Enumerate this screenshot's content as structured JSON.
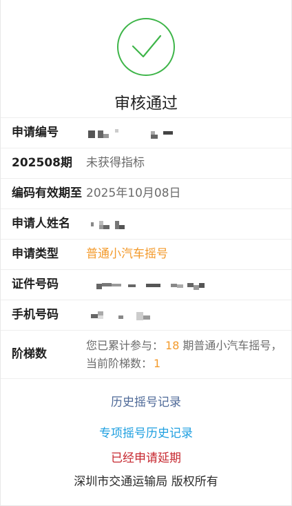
{
  "status": {
    "title": "审核通过",
    "icon": "success-check-icon"
  },
  "info": {
    "application_number": {
      "label": "申请编号"
    },
    "period_result": {
      "label": "202508期",
      "value": "未获得指标"
    },
    "code_valid_until": {
      "label": "编码有效期至",
      "value": "2025年10月08日"
    },
    "applicant_name": {
      "label": "申请人姓名"
    },
    "application_type": {
      "label": "申请类型",
      "value": "普通小汽车摇号"
    },
    "id_number": {
      "label": "证件号码"
    },
    "phone_number": {
      "label": "手机号码"
    },
    "ladder": {
      "label": "阶梯数",
      "text_before_count": "您已累计参与：",
      "count": "18",
      "text_after_count": "期普通小汽车摇号，",
      "level_text": "当前阶梯数：",
      "level": "1"
    }
  },
  "links": {
    "history": "历史摇号记录",
    "special_history": "专项摇号历史记录"
  },
  "extension_status": "已经申请延期",
  "footer": {
    "copyright": "深圳市交通运输局 版权所有"
  },
  "colors": {
    "success": "#3eb549",
    "highlight": "#f39a2b",
    "link_history": "#4f6a98",
    "link_special": "#1e9fe0",
    "status_red": "#c6262e"
  }
}
